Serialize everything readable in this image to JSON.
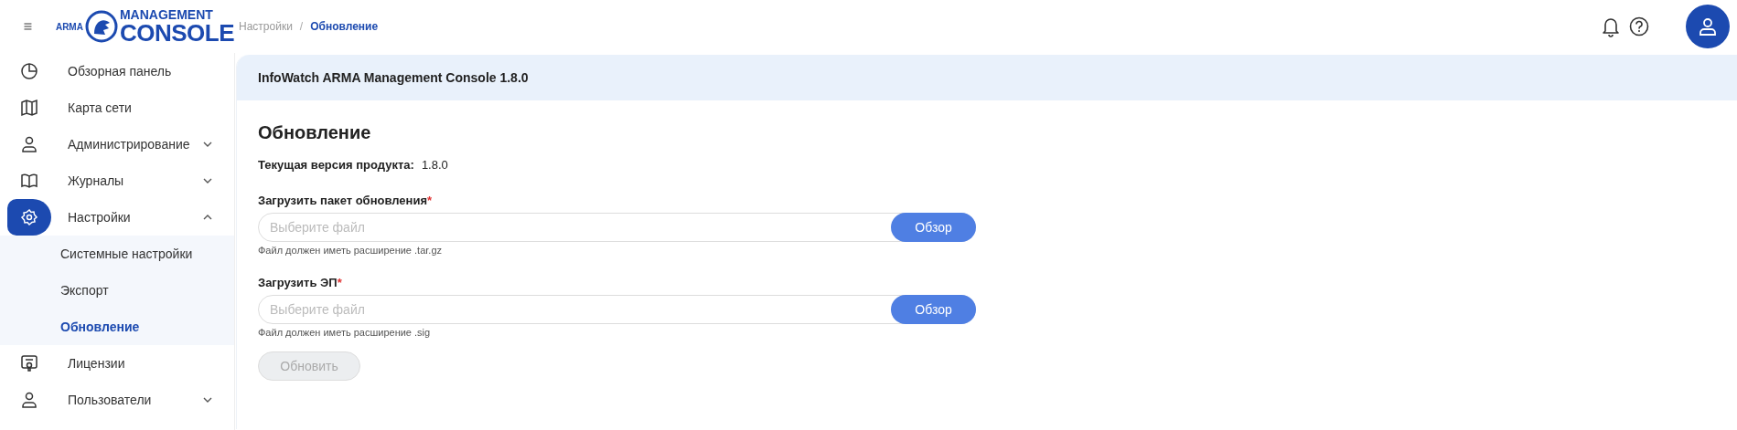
{
  "logo": {
    "small": "ARMA",
    "top": "MANAGEMENT",
    "bottom": "CONSOLE"
  },
  "breadcrumbs": [
    {
      "label": "Настройки",
      "selected": false
    },
    {
      "label": "Обновление",
      "selected": true
    }
  ],
  "breadcrumb_separator": "/",
  "sidebar": {
    "items": [
      {
        "label": "Обзорная панель",
        "kind": "link",
        "selected": false
      },
      {
        "label": "Карта сети",
        "kind": "link",
        "selected": false
      },
      {
        "label": "Администрирование",
        "kind": "group",
        "selected": false,
        "expanded": false
      },
      {
        "label": "Журналы",
        "kind": "group",
        "selected": false,
        "expanded": false
      },
      {
        "label": "Настройки",
        "kind": "group",
        "selected": true,
        "expanded": true,
        "children": [
          {
            "label": "Системные настройки",
            "selected": false
          },
          {
            "label": "Экспорт",
            "selected": false
          },
          {
            "label": "Обновление",
            "selected": true
          }
        ]
      },
      {
        "label": "Лицензии",
        "kind": "link",
        "selected": false
      },
      {
        "label": "Пользователи",
        "kind": "group",
        "selected": false,
        "expanded": false
      }
    ]
  },
  "panel": {
    "title": "InfoWatch ARMA Management Console 1.8.0",
    "heading": "Обновление",
    "version": {
      "label": "Текущая версия продукта:",
      "value": "1.8.0"
    },
    "fields": [
      {
        "label": "Загрузить пакет обновления",
        "required_mark": "*",
        "placeholder": "Выберите файл",
        "button": "Обзор",
        "hint": "Файл должен иметь расширение .tar.gz"
      },
      {
        "label": "Загрузить ЭП",
        "required_mark": "*",
        "placeholder": "Выберите файл",
        "button": "Обзор",
        "hint": "Файл должен иметь расширение .sig"
      }
    ],
    "submit": {
      "label": "Обновить",
      "disabled": true
    }
  }
}
